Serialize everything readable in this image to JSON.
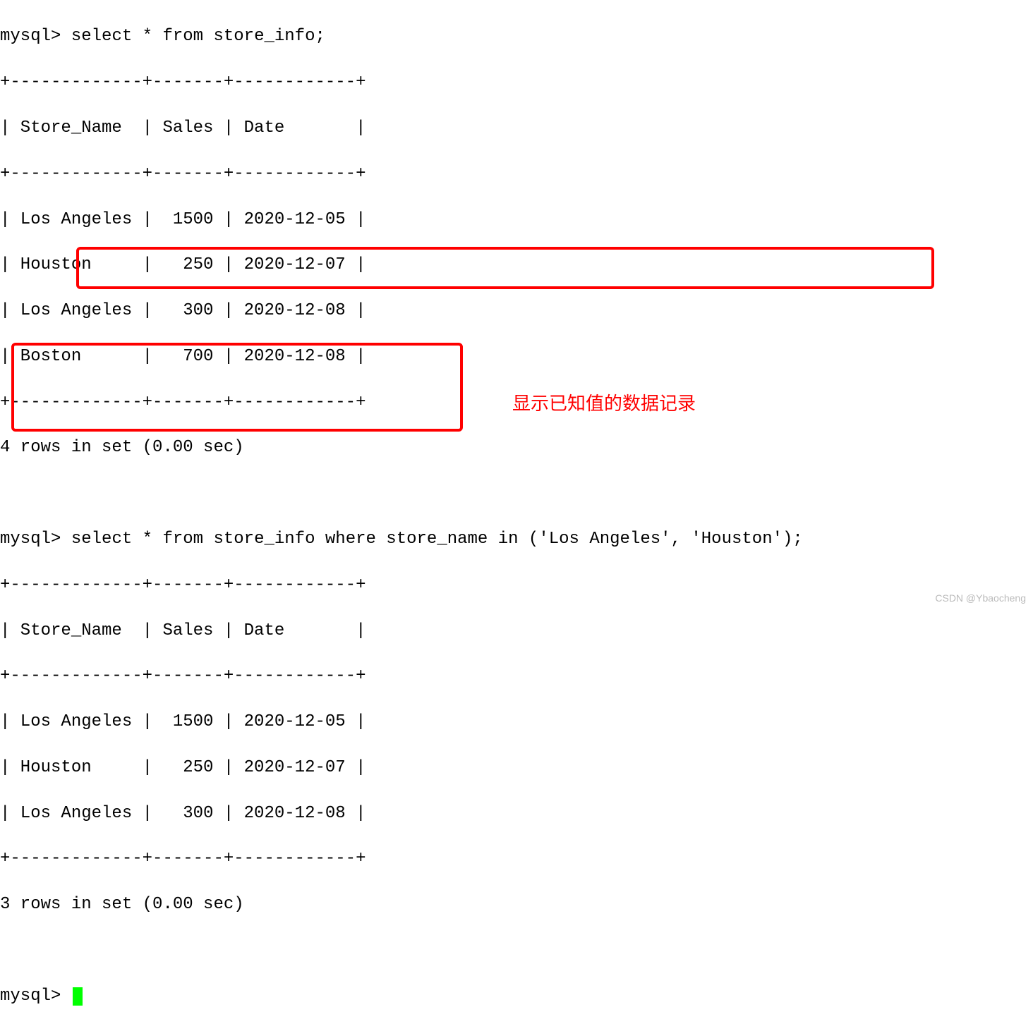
{
  "prompt": "mysql> ",
  "query1": {
    "text": "select * from store_info;",
    "sep": "+-------------+-------+------------+",
    "header": "| Store_Name  | Sales | Date       |",
    "rows": [
      "| Los Angeles |  1500 | 2020-12-05 |",
      "| Houston     |   250 | 2020-12-07 |",
      "| Los Angeles |   300 | 2020-12-08 |",
      "| Boston      |   700 | 2020-12-08 |"
    ],
    "summary": "4 rows in set (0.00 sec)"
  },
  "query2": {
    "text": "select * from store_info where store_name in ('Los Angeles', 'Houston');",
    "sep": "+-------------+-------+------------+",
    "header": "| Store_Name  | Sales | Date       |",
    "rows": [
      "| Los Angeles |  1500 | 2020-12-05 |",
      "| Houston     |   250 | 2020-12-07 |",
      "| Los Angeles |   300 | 2020-12-08 |"
    ],
    "summary": "3 rows in set (0.00 sec)"
  },
  "annotation": "显示已知值的数据记录",
  "watermark": "CSDN @Ybaocheng"
}
